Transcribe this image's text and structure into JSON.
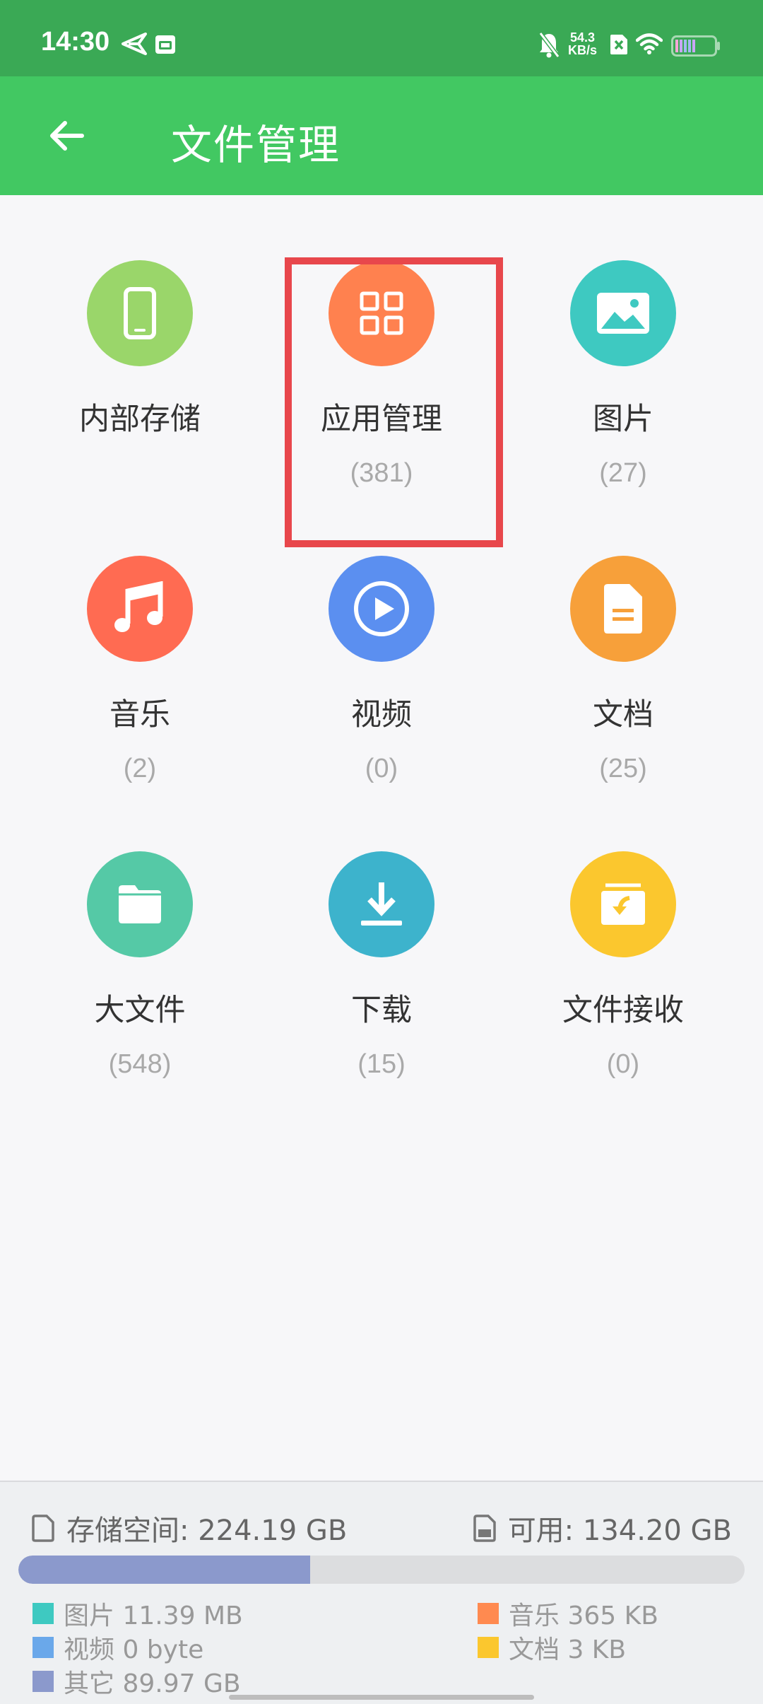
{
  "status_bar": {
    "time": "14:30",
    "net_speed_value": "54.3",
    "net_speed_unit": "KB/s"
  },
  "app_bar": {
    "back_icon": "arrow-left-icon",
    "title": "文件管理"
  },
  "categories": [
    {
      "label": "内部存储",
      "count": "",
      "color": "#9ad66a",
      "icon": "phone-icon"
    },
    {
      "label": "应用管理",
      "count": "(381)",
      "color": "#ff814f",
      "icon": "grid-icon"
    },
    {
      "label": "图片",
      "count": "(27)",
      "color": "#3ec9c1",
      "icon": "image-icon"
    },
    {
      "label": "音乐",
      "count": "(2)",
      "color": "#ff6b52",
      "icon": "music-note-icon"
    },
    {
      "label": "视频",
      "count": "(0)",
      "color": "#5b8ff0",
      "icon": "play-icon"
    },
    {
      "label": "文档",
      "count": "(25)",
      "color": "#f7a03a",
      "icon": "document-icon"
    },
    {
      "label": "大文件",
      "count": "(548)",
      "color": "#55c9a6",
      "icon": "folder-icon"
    },
    {
      "label": "下载",
      "count": "(15)",
      "color": "#3db3cc",
      "icon": "download-icon"
    },
    {
      "label": "文件接收",
      "count": "(0)",
      "color": "#fbc72e",
      "icon": "inbox-icon"
    }
  ],
  "storage": {
    "total_label": "存储空间: 224.19 GB",
    "available_label": "可用: 134.20 GB",
    "used_fraction": 0.402,
    "used_color": "#8b99cc",
    "legend": [
      {
        "label": "图片 11.39 MB",
        "color": "#3ec9c1"
      },
      {
        "label": "音乐 365 KB",
        "color": "#ff8a50"
      },
      {
        "label": "视频 0 byte",
        "color": "#6aa8ea"
      },
      {
        "label": "文档 3 KB",
        "color": "#fbc72e"
      },
      {
        "label": "其它 89.97 GB",
        "color": "#8b99cc"
      }
    ]
  }
}
